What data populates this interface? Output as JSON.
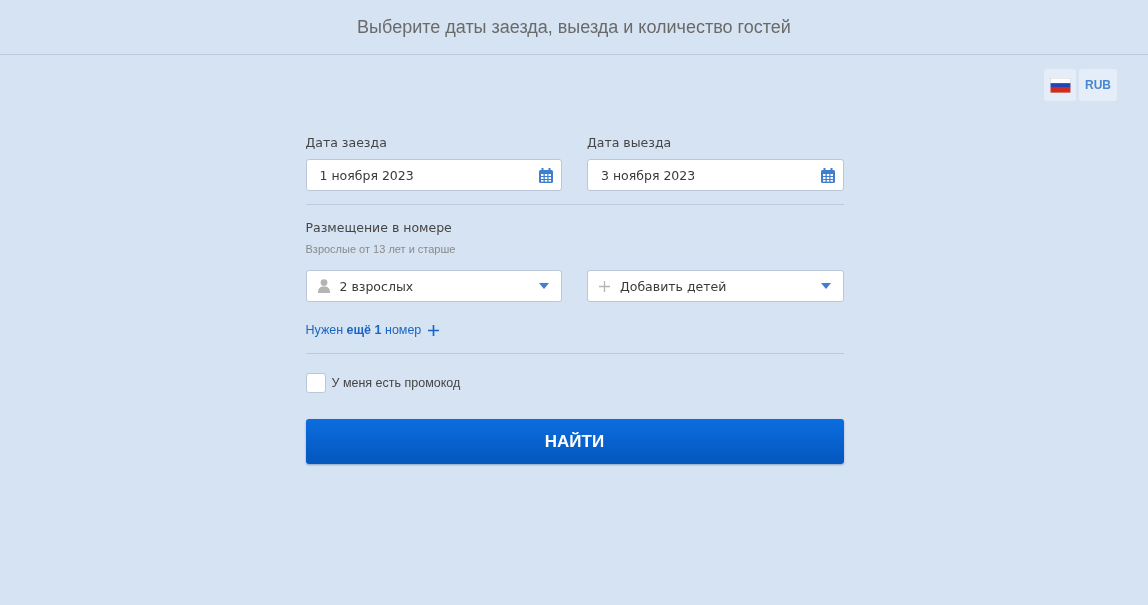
{
  "header": {
    "title": "Выберите даты заезда, выезда и количество гостей"
  },
  "locale": {
    "currency": "RUB"
  },
  "dates": [
    {
      "label": "Дата заезда",
      "value": "1 ноября 2023"
    },
    {
      "label": "Дата выезда",
      "value": "3 ноября 2023"
    }
  ],
  "accommodation": {
    "title": "Размещение в номере",
    "hint": "Взрослые от 13 лет и старше",
    "selects": [
      {
        "kind": "adults",
        "value": "2 взрослых"
      },
      {
        "kind": "children",
        "value": "Добавить детей"
      }
    ]
  },
  "add_room_link": "Нужен **ещё 1** номер",
  "promo": {
    "label": "У меня есть промокод",
    "checked": false
  },
  "search_button": "НАЙТИ"
}
